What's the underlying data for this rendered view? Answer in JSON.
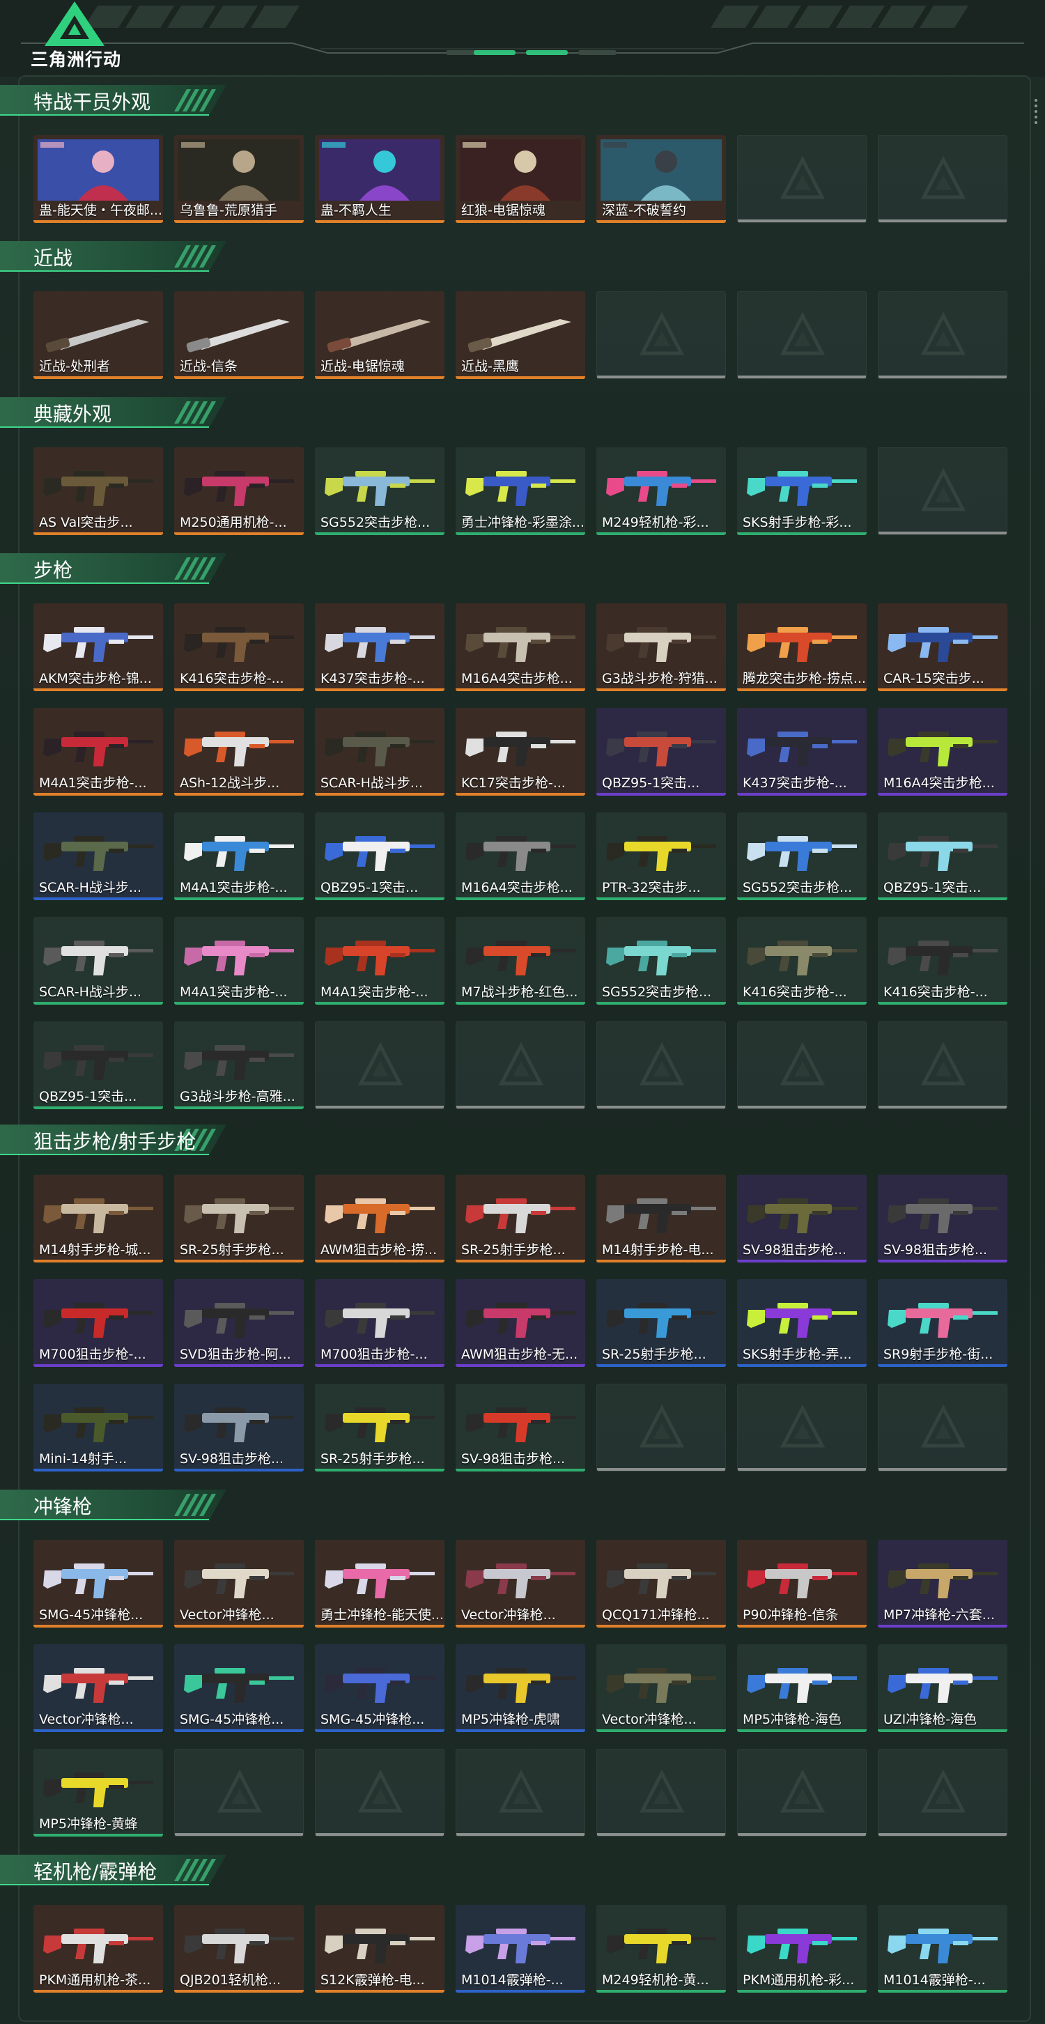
{
  "app": {
    "title": "三角洲行动"
  },
  "colors": {
    "gold": "#e0802a",
    "purple": "#6b3fc9",
    "blue": "#2d63c9",
    "green": "#2fae6f",
    "gray": "#8a8f8d",
    "accent": "#2fd17e"
  },
  "sections": [
    {
      "title": "特战干员外观",
      "items": [
        {
          "name": "蛊-能天使・午夜邮...",
          "rarity": "gold",
          "kind": "operator",
          "palette": [
            "#3a4fa8",
            "#c0304e",
            "#e8b0c4"
          ]
        },
        {
          "name": "乌鲁鲁-荒原猎手",
          "rarity": "gold",
          "kind": "operator",
          "palette": [
            "#2a2a22",
            "#7a6e58",
            "#b8a68a"
          ]
        },
        {
          "name": "蛊-不羁人生",
          "rarity": "gold",
          "kind": "operator",
          "palette": [
            "#3b2a6a",
            "#8a46c8",
            "#35c8d8"
          ]
        },
        {
          "name": "红狼-电锯惊魂",
          "rarity": "gold",
          "kind": "operator",
          "palette": [
            "#3a2222",
            "#8a3a2a",
            "#d6c8a8"
          ]
        },
        {
          "name": "深蓝-不破誓约",
          "rarity": "gold",
          "kind": "operator",
          "palette": [
            "#2d5a6a",
            "#7ab8c6",
            "#3a4048"
          ]
        },
        {
          "empty": true
        },
        {
          "empty": true
        }
      ]
    },
    {
      "title": "近战",
      "items": [
        {
          "name": "近战-处刑者",
          "rarity": "gold",
          "kind": "melee",
          "palette": [
            "#3a2a22",
            "#c8c8c8",
            "#5a4a3a"
          ]
        },
        {
          "name": "近战-信条",
          "rarity": "gold",
          "kind": "melee",
          "palette": [
            "#2a2a2a",
            "#dcdcdc",
            "#8a8a8a"
          ]
        },
        {
          "name": "近战-电锯惊魂",
          "rarity": "gold",
          "kind": "melee",
          "palette": [
            "#3a2a26",
            "#c8b8a8",
            "#7a4a3a"
          ]
        },
        {
          "name": "近战-黑鹰",
          "rarity": "gold",
          "kind": "melee",
          "palette": [
            "#2a2420",
            "#e0d8c8",
            "#6a5a48"
          ]
        },
        {
          "empty": true
        },
        {
          "empty": true
        },
        {
          "empty": true
        }
      ]
    },
    {
      "title": "典藏外观",
      "items": [
        {
          "name": "AS Val突击步...",
          "rarity": "gold",
          "palette": [
            "#3a2a20",
            "#6a5a3a",
            "#2a2a22"
          ]
        },
        {
          "name": "M250通用机枪-...",
          "rarity": "gold",
          "palette": [
            "#3a2a2a",
            "#c83a6a",
            "#2a2226"
          ]
        },
        {
          "name": "SG552突击步枪...",
          "rarity": "green",
          "palette": [
            "#24352e",
            "#8ab8d8",
            "#c8d84a"
          ]
        },
        {
          "name": "勇士冲锋枪-彩墨涂...",
          "rarity": "green",
          "palette": [
            "#24352e",
            "#3a5ac8",
            "#d8e84a"
          ]
        },
        {
          "name": "M249轻机枪-彩...",
          "rarity": "green",
          "palette": [
            "#24352e",
            "#3a8ad8",
            "#e84a8a"
          ]
        },
        {
          "name": "SKS射手步枪-彩...",
          "rarity": "green",
          "palette": [
            "#24352e",
            "#3a6ad8",
            "#4ad8c8"
          ]
        },
        {
          "empty": true
        }
      ]
    },
    {
      "title": "步枪",
      "items": [
        {
          "name": "AKM突击步枪-锦...",
          "rarity": "gold",
          "palette": [
            "#3a2a22",
            "#4a6ac8",
            "#e8e8f0"
          ]
        },
        {
          "name": "K416突击步枪-...",
          "rarity": "gold",
          "palette": [
            "#3a2a22",
            "#7a5a3a",
            "#2a2422"
          ]
        },
        {
          "name": "K437突击步枪-...",
          "rarity": "gold",
          "palette": [
            "#3a2a22",
            "#4a7ad8",
            "#d8d8e0"
          ]
        },
        {
          "name": "M16A4突击步枪...",
          "rarity": "gold",
          "palette": [
            "#3a2a22",
            "#c8c0b0",
            "#5a4a3a"
          ]
        },
        {
          "name": "G3战斗步枪-狩猎...",
          "rarity": "gold",
          "palette": [
            "#3a2a22",
            "#d8d0c0",
            "#4a3a30"
          ]
        },
        {
          "name": "腾龙突击步枪-捞点...",
          "rarity": "gold",
          "palette": [
            "#3a2a22",
            "#d84a2a",
            "#f0a04a"
          ]
        },
        {
          "name": "CAR-15突击步...",
          "rarity": "gold",
          "palette": [
            "#3a2a22",
            "#2a4a98",
            "#8ab8f0"
          ]
        },
        {
          "name": "M4A1突击步枪-...",
          "rarity": "gold",
          "palette": [
            "#3a2a22",
            "#c82a3a",
            "#2a2226"
          ]
        },
        {
          "name": "ASh-12战斗步...",
          "rarity": "gold",
          "palette": [
            "#3a2a22",
            "#e0e0e0",
            "#d85a2a"
          ]
        },
        {
          "name": "SCAR-H战斗步...",
          "rarity": "gold",
          "palette": [
            "#3a2a22",
            "#5a5a4a",
            "#2a2a22"
          ]
        },
        {
          "name": "KC17突击步枪-...",
          "rarity": "gold",
          "palette": [
            "#3a2a22",
            "#2a2a2a",
            "#e0e0e0"
          ]
        },
        {
          "name": "QBZ95-1突击...",
          "rarity": "purple",
          "palette": [
            "#2e2a44",
            "#c84a3a",
            "#3a3a48"
          ]
        },
        {
          "name": "K437突击步枪-...",
          "rarity": "purple",
          "palette": [
            "#2e2a44",
            "#2a2a34",
            "#4a6ac8"
          ]
        },
        {
          "name": "M16A4突击步枪...",
          "rarity": "purple",
          "palette": [
            "#2e2a44",
            "#b8e83a",
            "#3a3a2a"
          ]
        },
        {
          "name": "SCAR-H战斗步...",
          "rarity": "blue",
          "palette": [
            "#26303e",
            "#5a6a4a",
            "#2a2a22"
          ]
        },
        {
          "name": "M4A1突击步枪-...",
          "rarity": "green",
          "palette": [
            "#24352e",
            "#3a8ad8",
            "#f0f0f0"
          ]
        },
        {
          "name": "QBZ95-1突击...",
          "rarity": "green",
          "palette": [
            "#24352e",
            "#f0f0f0",
            "#3a6ad8"
          ]
        },
        {
          "name": "M16A4突击步枪...",
          "rarity": "green",
          "palette": [
            "#24352e",
            "#8a8a8a",
            "#2a2a2a"
          ]
        },
        {
          "name": "PTR-32突击步...",
          "rarity": "green",
          "palette": [
            "#24352e",
            "#e8d82a",
            "#2a2a22"
          ]
        },
        {
          "name": "SG552突击步枪...",
          "rarity": "green",
          "palette": [
            "#24352e",
            "#3a7ad8",
            "#c8e0f0"
          ]
        },
        {
          "name": "QBZ95-1突击...",
          "rarity": "green",
          "palette": [
            "#24352e",
            "#8ad8e8",
            "#3a3a3a"
          ]
        },
        {
          "name": "SCAR-H战斗步...",
          "rarity": "green",
          "palette": [
            "#24352e",
            "#e0e0e0",
            "#5a5a5a"
          ]
        },
        {
          "name": "M4A1突击步枪-...",
          "rarity": "green",
          "palette": [
            "#24352e",
            "#e88ac8",
            "#c86aa8"
          ]
        },
        {
          "name": "M4A1突击步枪-...",
          "rarity": "green",
          "palette": [
            "#24352e",
            "#d8442a",
            "#a8321e"
          ]
        },
        {
          "name": "M7战斗步枪-红色...",
          "rarity": "green",
          "palette": [
            "#24352e",
            "#d84a2a",
            "#2a2a2a"
          ]
        },
        {
          "name": "SG552突击步枪...",
          "rarity": "green",
          "palette": [
            "#24352e",
            "#7ad8d0",
            "#4aa8a0"
          ]
        },
        {
          "name": "K416突击步枪-...",
          "rarity": "green",
          "palette": [
            "#24352e",
            "#8a8a6a",
            "#4a4a3a"
          ]
        },
        {
          "name": "K416突击步枪-...",
          "rarity": "green",
          "palette": [
            "#24352e",
            "#2a2a2a",
            "#4a4a4a"
          ]
        },
        {
          "name": "QBZ95-1突击...",
          "rarity": "green",
          "palette": [
            "#24352e",
            "#2a2a2a",
            "#3a3a3a"
          ]
        },
        {
          "name": "G3战斗步枪-高雅...",
          "rarity": "green",
          "palette": [
            "#24352e",
            "#2a2a2a",
            "#4a4a4a"
          ]
        },
        {
          "empty": true
        },
        {
          "empty": true
        },
        {
          "empty": true
        },
        {
          "empty": true
        },
        {
          "empty": true
        }
      ]
    },
    {
      "title": "狙击步枪/射手步枪",
      "items": [
        {
          "name": "M14射手步枪-城...",
          "rarity": "gold",
          "palette": [
            "#3a2a22",
            "#c8b8a0",
            "#7a5a3a"
          ]
        },
        {
          "name": "SR-25射手步枪...",
          "rarity": "gold",
          "palette": [
            "#3a2a22",
            "#c8c0b0",
            "#6a5a4a"
          ]
        },
        {
          "name": "AWM狙击步枪-捞...",
          "rarity": "gold",
          "palette": [
            "#3a2a22",
            "#d86a2a",
            "#e8c8a8"
          ]
        },
        {
          "name": "SR-25射手步枪...",
          "rarity": "gold",
          "palette": [
            "#3a2a22",
            "#d8d8d8",
            "#c83a3a"
          ]
        },
        {
          "name": "M14射手步枪-电...",
          "rarity": "gold",
          "palette": [
            "#3a2a22",
            "#2a2a2a",
            "#7a7a7a"
          ]
        },
        {
          "name": "SV-98狙击步枪...",
          "rarity": "purple",
          "palette": [
            "#2e2a44",
            "#6a6a3a",
            "#3a3a2a"
          ]
        },
        {
          "name": "SV-98狙击步枪...",
          "rarity": "purple",
          "palette": [
            "#2e2a44",
            "#6a6a6a",
            "#3a3a3a"
          ]
        },
        {
          "name": "M700狙击步枪-...",
          "rarity": "purple",
          "palette": [
            "#2e2a44",
            "#c82a2a",
            "#2a2a2a"
          ]
        },
        {
          "name": "SVD狙击步枪-阿...",
          "rarity": "purple",
          "palette": [
            "#2e2a44",
            "#2a2a2a",
            "#5a5a5a"
          ]
        },
        {
          "name": "M700狙击步枪-...",
          "rarity": "purple",
          "palette": [
            "#2e2a44",
            "#d8d8d8",
            "#3a3a3a"
          ]
        },
        {
          "name": "AWM狙击步枪-无...",
          "rarity": "purple",
          "palette": [
            "#2e2a44",
            "#c83a6a",
            "#2a2a2a"
          ]
        },
        {
          "name": "SR-25射手步枪...",
          "rarity": "blue",
          "palette": [
            "#26303e",
            "#3a9ad8",
            "#2a2a2a"
          ]
        },
        {
          "name": "SKS射手步枪-弄...",
          "rarity": "blue",
          "palette": [
            "#26303e",
            "#8a3ad8",
            "#c8f03a"
          ]
        },
        {
          "name": "SR9射手步枪-街...",
          "rarity": "blue",
          "palette": [
            "#26303e",
            "#e86a9a",
            "#4ad8c8"
          ]
        },
        {
          "name": "Mini-14射手...",
          "rarity": "blue",
          "palette": [
            "#26303e",
            "#4a5a2a",
            "#2a2a22"
          ]
        },
        {
          "name": "SV-98狙击步枪...",
          "rarity": "blue",
          "palette": [
            "#26303e",
            "#8a9aa8",
            "#2a2a2a"
          ]
        },
        {
          "name": "SR-25射手步枪...",
          "rarity": "green",
          "palette": [
            "#24352e",
            "#e8d82a",
            "#2a2a2a"
          ]
        },
        {
          "name": "SV-98狙击步枪...",
          "rarity": "green",
          "palette": [
            "#24352e",
            "#d83a2a",
            "#2a2a2a"
          ]
        },
        {
          "empty": true
        },
        {
          "empty": true
        },
        {
          "empty": true
        }
      ]
    },
    {
      "title": "冲锋枪",
      "items": [
        {
          "name": "SMG-45冲锋枪...",
          "rarity": "gold",
          "palette": [
            "#3a2a22",
            "#8ab8e8",
            "#d8d8e8"
          ]
        },
        {
          "name": "Vector冲锋枪...",
          "rarity": "gold",
          "palette": [
            "#3a2a22",
            "#e0d8c8",
            "#3a3a3a"
          ]
        },
        {
          "name": "勇士冲锋枪-能天使...",
          "rarity": "gold",
          "palette": [
            "#3a2a22",
            "#e86aa8",
            "#d8d8e8"
          ]
        },
        {
          "name": "Vector冲锋枪...",
          "rarity": "gold",
          "palette": [
            "#3a2a22",
            "#c8c8d0",
            "#8a3a4a"
          ]
        },
        {
          "name": "QCQ171冲锋枪...",
          "rarity": "gold",
          "palette": [
            "#3a2a22",
            "#d8d0c0",
            "#3a3a3a"
          ]
        },
        {
          "name": "P90冲锋枪-信条",
          "rarity": "gold",
          "palette": [
            "#3a2a22",
            "#c8c8c8",
            "#c82a3a"
          ]
        },
        {
          "name": "MP7冲锋枪-六套...",
          "rarity": "purple",
          "palette": [
            "#2e2a44",
            "#c8a86a",
            "#3a3a2a"
          ]
        },
        {
          "name": "Vector冲锋枪...",
          "rarity": "blue",
          "palette": [
            "#26303e",
            "#c83a3a",
            "#e0e0e0"
          ]
        },
        {
          "name": "SMG-45冲锋枪...",
          "rarity": "blue",
          "palette": [
            "#26303e",
            "#2a2a2a",
            "#3ac89a"
          ]
        },
        {
          "name": "SMG-45冲锋枪...",
          "rarity": "blue",
          "palette": [
            "#26303e",
            "#4a6ad8",
            "#2a2a3a"
          ]
        },
        {
          "name": "MP5冲锋枪-虎啸",
          "rarity": "blue",
          "palette": [
            "#26303e",
            "#e8c82a",
            "#2a2a2a"
          ]
        },
        {
          "name": "Vector冲锋枪...",
          "rarity": "green",
          "palette": [
            "#24352e",
            "#7a7a5a",
            "#3a3a2a"
          ]
        },
        {
          "name": "MP5冲锋枪-海色",
          "rarity": "green",
          "palette": [
            "#24352e",
            "#f0f0f0",
            "#3a7ad8"
          ]
        },
        {
          "name": "UZI冲锋枪-海色",
          "rarity": "green",
          "palette": [
            "#24352e",
            "#f0f0f0",
            "#3a6ad8"
          ]
        },
        {
          "name": "MP5冲锋枪-黄蜂",
          "rarity": "green",
          "palette": [
            "#24352e",
            "#e8d82a",
            "#2a2a2a"
          ]
        },
        {
          "empty": true
        },
        {
          "empty": true
        },
        {
          "empty": true
        },
        {
          "empty": true
        },
        {
          "empty": true
        },
        {
          "empty": true
        }
      ]
    },
    {
      "title": "轻机枪/霰弹枪",
      "items": [
        {
          "name": "PKM通用机枪-茶...",
          "rarity": "gold",
          "palette": [
            "#3a2a22",
            "#e0e0e0",
            "#c83a3a"
          ]
        },
        {
          "name": "QJB201轻机枪...",
          "rarity": "gold",
          "palette": [
            "#3a2a22",
            "#d8d8d8",
            "#3a3a3a"
          ]
        },
        {
          "name": "S12K霰弹枪-电...",
          "rarity": "gold",
          "palette": [
            "#3a2a22",
            "#2a2a2a",
            "#d8d0c0"
          ]
        },
        {
          "name": "M1014霰弹枪-...",
          "rarity": "blue",
          "palette": [
            "#26303e",
            "#6a7ad8",
            "#c8a0e8"
          ]
        },
        {
          "name": "M249轻机枪-黄...",
          "rarity": "green",
          "palette": [
            "#24352e",
            "#e8d82a",
            "#2a2a2a"
          ]
        },
        {
          "name": "PKM通用机枪-彩...",
          "rarity": "green",
          "palette": [
            "#24352e",
            "#8a3ad8",
            "#3ad8c8"
          ]
        },
        {
          "name": "M1014霰弹枪-...",
          "rarity": "green",
          "palette": [
            "#24352e",
            "#3a8ad8",
            "#8ad8f0"
          ]
        }
      ]
    }
  ]
}
